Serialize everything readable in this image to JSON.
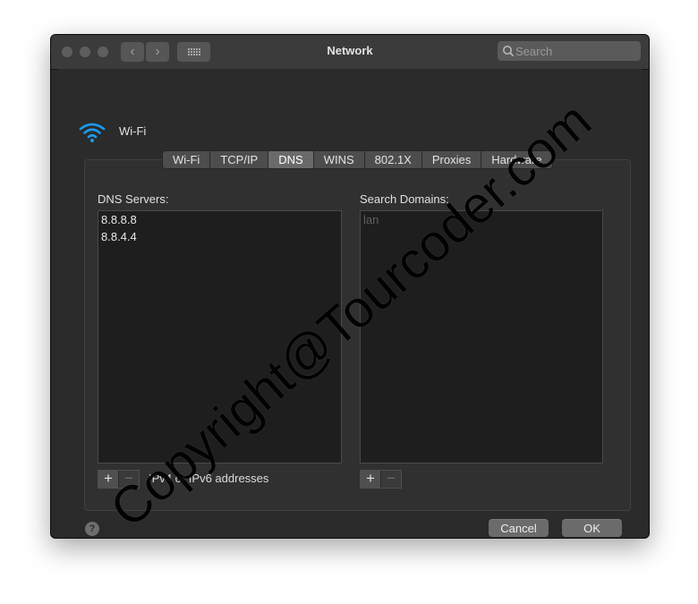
{
  "window": {
    "title": "Network",
    "search_placeholder": "Search",
    "nav_back_glyph": "‹",
    "nav_forward_glyph": "›"
  },
  "connection": {
    "icon": "wifi-icon",
    "label": "Wi-Fi"
  },
  "tabs": [
    {
      "label": "Wi-Fi",
      "selected": false
    },
    {
      "label": "TCP/IP",
      "selected": false
    },
    {
      "label": "DNS",
      "selected": true
    },
    {
      "label": "WINS",
      "selected": false
    },
    {
      "label": "802.1X",
      "selected": false
    },
    {
      "label": "Proxies",
      "selected": false
    },
    {
      "label": "Hardware",
      "selected": false
    }
  ],
  "dns": {
    "servers_label": "DNS Servers:",
    "servers": [
      "8.8.8.8",
      "8.8.4.4"
    ],
    "hint": "IPv4 or IPv6 addresses",
    "domains_label": "Search Domains:",
    "domains": [
      "lan"
    ]
  },
  "controls": {
    "plus": "+",
    "minus": "−"
  },
  "footer": {
    "help": "?",
    "cancel": "Cancel",
    "ok": "OK"
  },
  "watermark": "Copyright@Tourcoder.com",
  "colors": {
    "wifi_accent": "#1a9bf0",
    "window_bg": "#2a2a2a",
    "selected_tab": "#6a6a6a"
  }
}
